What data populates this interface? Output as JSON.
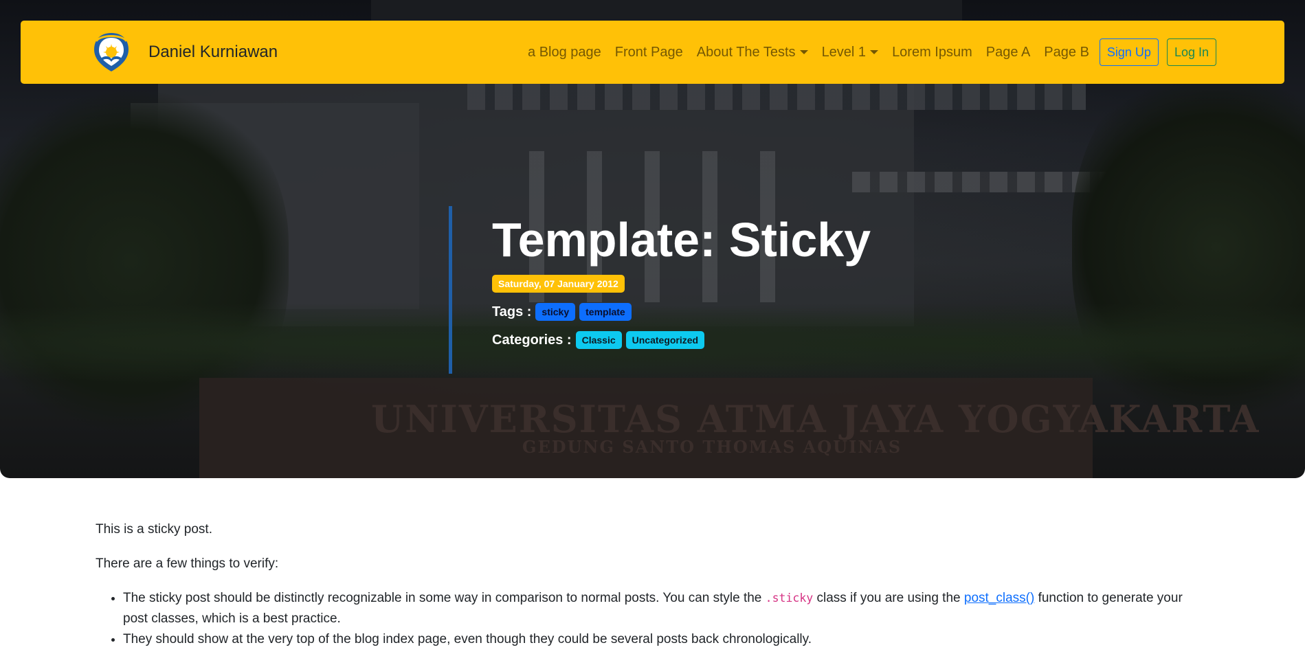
{
  "site": {
    "brand_name": "Daniel Kurniawan",
    "logo_icon": "university-logo-icon"
  },
  "nav": {
    "links": [
      {
        "label": "a Blog page",
        "dropdown": false
      },
      {
        "label": "Front Page",
        "dropdown": false
      },
      {
        "label": "About The Tests",
        "dropdown": true
      },
      {
        "label": "Level 1",
        "dropdown": true
      },
      {
        "label": "Lorem Ipsum",
        "dropdown": false
      },
      {
        "label": "Page A",
        "dropdown": false
      },
      {
        "label": "Page B",
        "dropdown": false
      }
    ],
    "signup_label": "Sign Up",
    "login_label": "Log In"
  },
  "hero": {
    "sign_text": "UNIVERSITAS ATMA JAYA YOGYAKARTA",
    "sign_subtext": "GEDUNG SANTO THOMAS AQUINAS"
  },
  "post": {
    "title": "Template: Sticky",
    "date": "Saturday, 07 January 2012",
    "tags_label": "Tags :",
    "tags": [
      "sticky",
      "template"
    ],
    "categories_label": "Categories :",
    "categories": [
      "Classic",
      "Uncategorized"
    ]
  },
  "content": {
    "p1": "This is a sticky post.",
    "p2": "There are a few things to verify:",
    "li1_a": "The sticky post should be distinctly recognizable in some way in comparison to normal posts. You can style the ",
    "li1_code": ".sticky",
    "li1_b": " class if you are using the ",
    "li1_link": "post_class()",
    "li1_c": " function to generate your post classes, which is a best practice.",
    "li2": "They should show at the very top of the blog index page, even though they could be several posts back chronologically."
  },
  "colors": {
    "navbar": "#ffc107",
    "primary": "#0d6efd",
    "success": "#198754",
    "info": "#0dcaf0",
    "accent_border": "#1f5fa8"
  }
}
